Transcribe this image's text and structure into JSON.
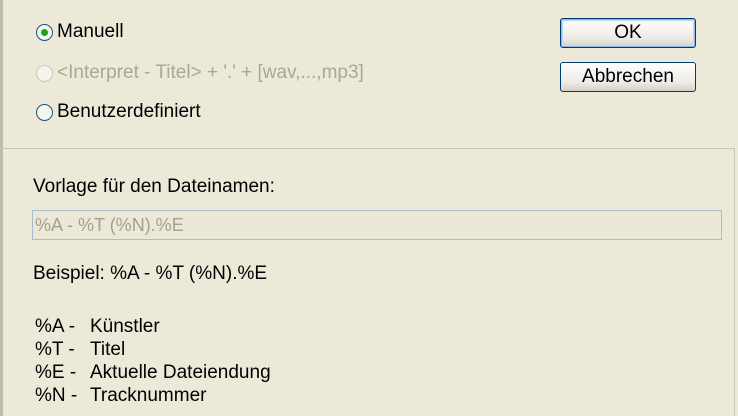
{
  "options": {
    "manual": {
      "label": "Manuell",
      "checked": true
    },
    "interpret": {
      "label": "<Interpret - Titel> + '.' + [wav,...,mp3]",
      "enabled": false
    },
    "custom": {
      "label": "Benutzerdefiniert",
      "checked": false
    }
  },
  "buttons": {
    "ok": "OK",
    "cancel": "Abbrechen"
  },
  "template": {
    "label": "Vorlage für den Dateinamen:",
    "value": "%A - %T (%N).%E"
  },
  "example": "Beispiel: %A - %T (%N).%E",
  "legend": [
    {
      "code": "%A -",
      "desc": "Künstler"
    },
    {
      "code": "%T -",
      "desc": "Titel"
    },
    {
      "code": "%E -",
      "desc": "Aktuelle Dateiendung"
    },
    {
      "code": "%N -",
      "desc": "Tracknummer"
    }
  ],
  "colors": {
    "dialog_bg": "#ece9d8",
    "radio_dot": "#21a121",
    "button_border": "#003c74",
    "disabled_text": "#a9a797"
  }
}
